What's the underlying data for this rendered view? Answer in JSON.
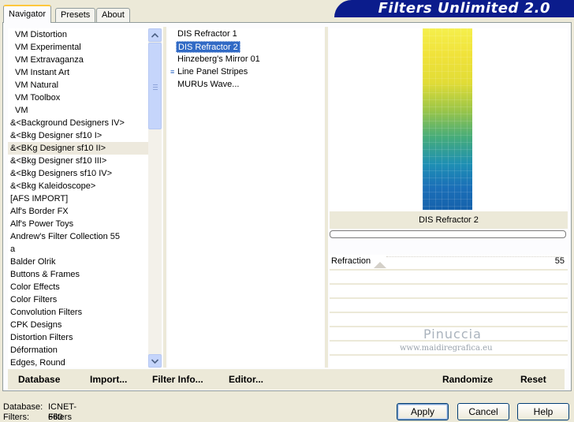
{
  "tabs": [
    {
      "label": "Navigator"
    },
    {
      "label": "Presets"
    },
    {
      "label": "About"
    }
  ],
  "app_title": "Filters Unlimited 2.0",
  "categories": [
    "VM Distortion",
    "VM Experimental",
    "VM Extravaganza",
    "VM Instant Art",
    "VM Natural",
    "VM Toolbox",
    "VM",
    "&<Background Designers IV>",
    "&<Bkg Designer sf10 I>",
    "&<BKg Designer sf10 II>",
    "&<Bkg Designer sf10 III>",
    "&<Bkg Designers sf10 IV>",
    "&<Bkg Kaleidoscope>",
    "[AFS IMPORT]",
    "Alf's Border FX",
    "Alf's Power Toys",
    "Andrew's Filter Collection 55",
    "a",
    "Balder Olrik",
    "Buttons & Frames",
    "Color Effects",
    "Color Filters",
    "Convolution Filters",
    "CPK Designs",
    "Distortion Filters",
    "Déformation",
    "Edges, Round"
  ],
  "selected_category_index": 9,
  "filters": [
    "DIS Refractor 1",
    "DIS Refractor 2",
    "Hinzeberg's Mirror 01",
    "Line Panel Stripes",
    "MURUs Wave..."
  ],
  "selected_filter_index": 1,
  "preview": {
    "filter_name": "DIS Refractor 2",
    "progress": 0
  },
  "parameters": [
    {
      "name": "Refraction",
      "value": "55",
      "level": 0.216
    }
  ],
  "watermark": {
    "name": "Pinuccia",
    "url": "www.maidiregrafica.eu"
  },
  "toolbar": {
    "database": "Database",
    "import": "Import...",
    "filter_info": "Filter Info...",
    "editor": "Editor...",
    "randomize": "Randomize",
    "reset": "Reset"
  },
  "status": {
    "database_label": "Database:",
    "database_value": "ICNET-Filters",
    "filters_label": "Filters:",
    "filters_value": "660"
  },
  "buttons": {
    "apply": "Apply",
    "cancel": "Cancel",
    "help": "Help"
  }
}
